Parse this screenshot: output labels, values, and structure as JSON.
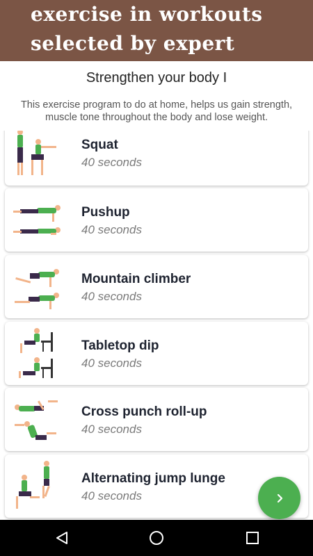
{
  "banner": {
    "line1": "exercise in workouts",
    "line2": "selected by expert"
  },
  "header": {
    "title": "Strengthen your body I",
    "description": "This exercise program to do at home, helps us gain strength, muscle tone throughout the body and lose weight."
  },
  "exercises": [
    {
      "name": "Squat",
      "duration": "40 seconds"
    },
    {
      "name": "Pushup",
      "duration": "40 seconds"
    },
    {
      "name": "Mountain climber",
      "duration": "40 seconds"
    },
    {
      "name": "Tabletop dip",
      "duration": "40 seconds"
    },
    {
      "name": "Cross punch roll-up",
      "duration": "40 seconds"
    },
    {
      "name": "Alternating jump lunge",
      "duration": "40 seconds"
    }
  ],
  "fab": {
    "icon": "chevron-right-icon",
    "color": "#4caf50"
  },
  "navbar": {
    "icons": [
      "back-icon",
      "home-icon",
      "recents-icon"
    ]
  },
  "colors": {
    "banner": "#7b5545",
    "figure_shirt": "#4caf50",
    "figure_pants": "#3a2a4a",
    "skin": "#f2b48a"
  }
}
